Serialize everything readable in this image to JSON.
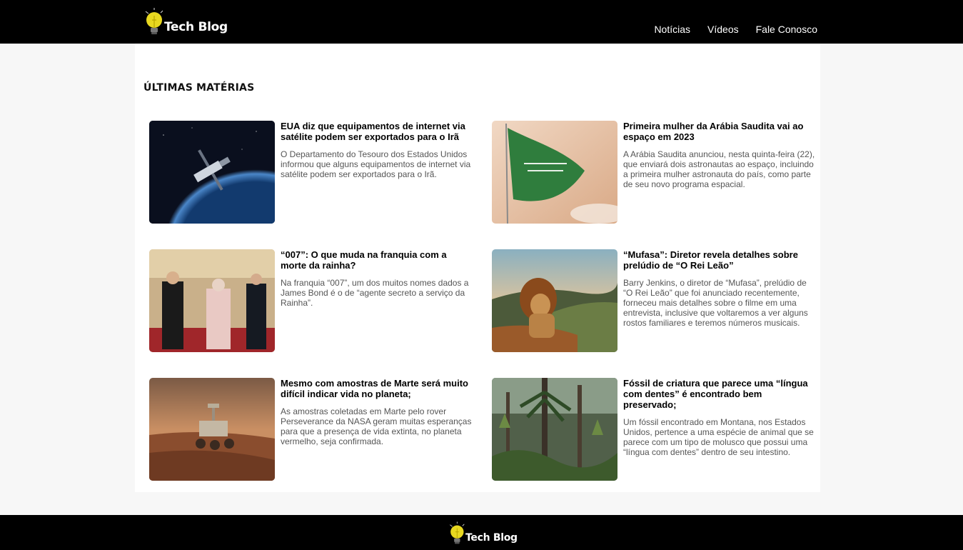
{
  "header": {
    "brand": "Tech Blog",
    "nav": [
      "Notícias",
      "Vídeos",
      "Fale Conosco"
    ]
  },
  "main": {
    "section_title": "ÚLTIMAS MATÉRIAS",
    "articles": [
      {
        "title": "EUA diz que equipamentos de internet via satélite podem ser exportados para o Irã",
        "excerpt": "O Departamento do Tesouro dos Estados Unidos informou que alguns equipamentos de internet via satélite podem ser exportados para o Irã."
      },
      {
        "title": "Primeira mulher da Arábia Saudita vai ao espaço em 2023",
        "excerpt": "A Arábia Saudita anunciou, nesta quinta-feira (22), que enviará dois astronautas ao espaço, incluindo a primeira mulher astronauta do país, como parte de seu novo programa espacial."
      },
      {
        "title": "“007”: O que muda na franquia com a morte da rainha?",
        "excerpt": "Na franquia “007”, um dos muitos nomes dados a James Bond é o de “agente secreto a serviço da Rainha”."
      },
      {
        "title": "“Mufasa”: Diretor revela detalhes sobre prelúdio de “O Rei Leão”",
        "excerpt": "Barry Jenkins, o diretor de “Mufasa”, prelúdio de “O Rei Leão” que foi anunciado recentemente, forneceu mais detalhes sobre o filme em uma entrevista, inclusive que voltaremos a ver alguns rostos familiares e teremos números musicais."
      },
      {
        "title": "Mesmo com amostras de Marte será muito difícil indicar vida no planeta;",
        "excerpt": "As amostras coletadas em Marte pelo rover Perseverance da NASA geram muitas esperanças para que a presença de vida extinta, no planeta vermelho, seja confirmada."
      },
      {
        "title": "Fóssil de criatura que parece uma “língua com dentes” é encontrado bem preservado;",
        "excerpt": "Um fóssil encontrado em Montana, nos Estados Unidos, pertence a uma espécie de animal que se parece com um tipo de molusco que possui uma “língua com dentes” dentro de seu intestino."
      }
    ]
  },
  "footer": {
    "brand": "Tech Blog"
  },
  "colors": {
    "bar": "#000000",
    "panel": "#ffffff",
    "page_bg": "#f7f7f7",
    "bulb": "#e8d820"
  }
}
